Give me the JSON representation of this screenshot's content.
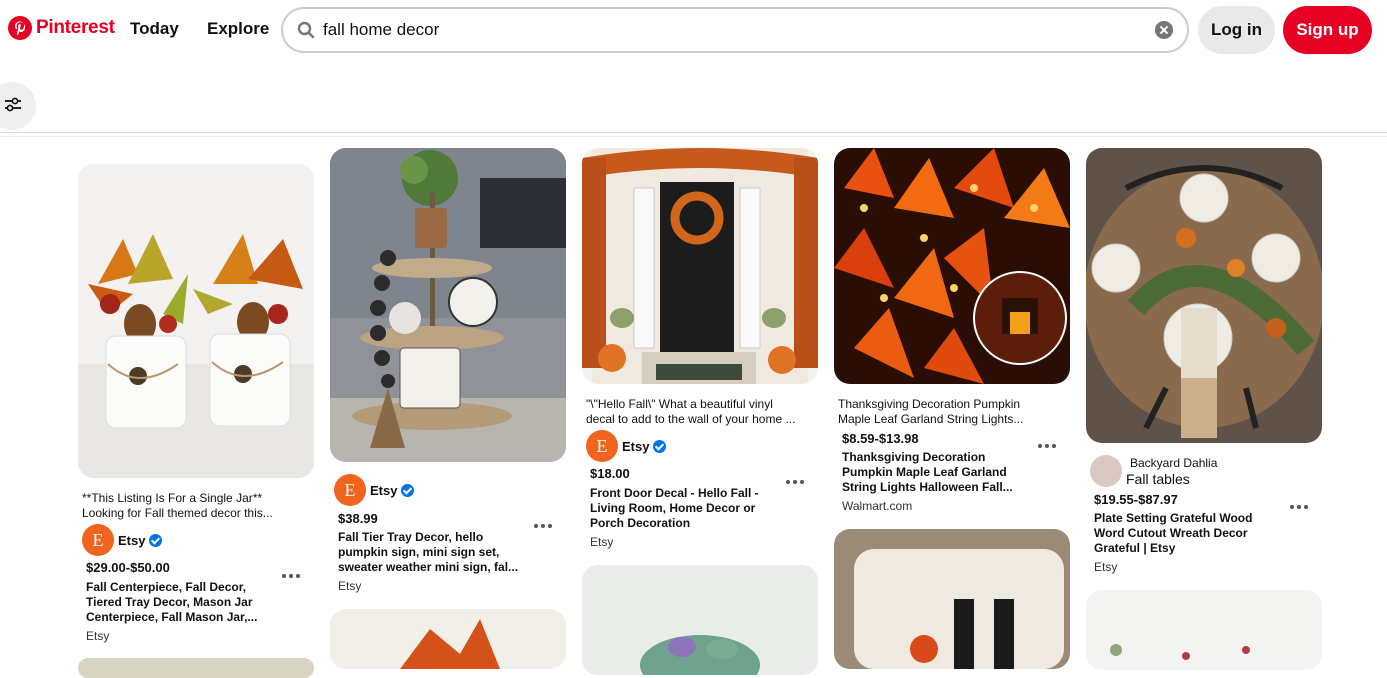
{
  "header": {
    "logo_text": "Pinterest",
    "nav": [
      "Today",
      "Explore"
    ],
    "search_value": "fall home decor",
    "login_label": "Log in",
    "signup_label": "Sign up"
  },
  "pins": [
    {
      "desc_line1": "**This Listing Is For a Single Jar**",
      "desc_line2": "Looking for Fall themed decor this...",
      "seller": "Etsy",
      "avatar_letter": "E",
      "price": "$29.00-$50.00",
      "title_lines": [
        "Fall Centerpiece, Fall Decor,",
        "Tiered Tray Decor, Mason Jar",
        "Centerpiece, Fall Mason Jar,..."
      ],
      "store": "Etsy"
    },
    {
      "seller": "Etsy",
      "avatar_letter": "E",
      "price": "$38.99",
      "title_lines": [
        "Fall Tier Tray Decor, hello",
        "pumpkin sign, mini sign set,",
        "sweater weather mini sign, fal..."
      ],
      "store": "Etsy"
    },
    {
      "desc_line1": "\"\\\"Hello Fall\\\" What a beautiful vinyl",
      "desc_line2": "decal to add to the wall of your home ...",
      "seller": "Etsy",
      "avatar_letter": "E",
      "price": "$18.00",
      "title_lines": [
        "Front Door Decal - Hello Fall -",
        "Living Room, Home Decor or",
        "Porch Decoration"
      ],
      "store": "Etsy"
    },
    {
      "desc_line1": "Thanksgiving Decoration Pumpkin",
      "desc_line2": "Maple Leaf Garland String Lights...",
      "price": "$8.59-$13.98",
      "title_lines": [
        "Thanksgiving Decoration",
        "Pumpkin Maple Leaf Garland",
        "String Lights Halloween Fall..."
      ],
      "store": "Walmart.com"
    },
    {
      "seller": "Backyard Dahlia",
      "board": "Fall tables",
      "price": "$19.55-$87.97",
      "title_lines": [
        "Plate Setting Grateful Wood",
        "Word Cutout Wreath Decor",
        "Grateful | Etsy"
      ],
      "store": "Etsy"
    }
  ],
  "colors": {
    "brand": "#e60023",
    "etsy": "#f1641e",
    "verified": "#0074e8"
  }
}
